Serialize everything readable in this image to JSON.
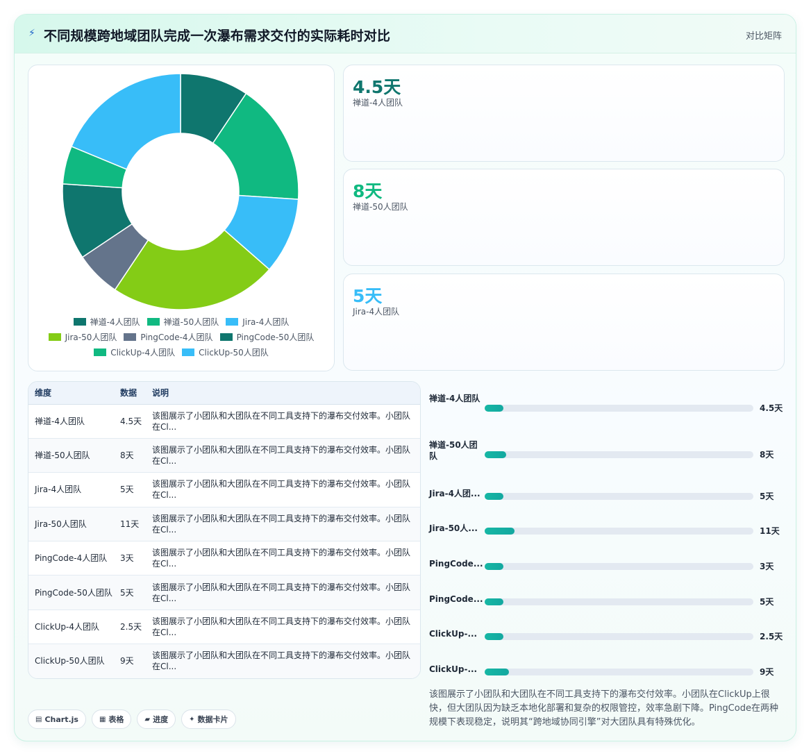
{
  "header": {
    "icon": "bolt-icon",
    "title": "不同规模跨地域团队完成一次瀑布需求交付的实际耗时对比",
    "right_label": "对比矩阵"
  },
  "colors": {
    "dark_teal": "#0f766e",
    "emerald": "#10b981",
    "sky": "#38bdf8",
    "lime": "#84cc16",
    "slate": "#64748b"
  },
  "chart_data": {
    "type": "pie",
    "variant": "donut",
    "categories": [
      "禅道-4人团队",
      "禅道-50人团队",
      "Jira-4人团队",
      "Jira-50人团队",
      "PingCode-4人团队",
      "PingCode-50人团队",
      "ClickUp-4人团队",
      "ClickUp-50人团队"
    ],
    "values": [
      4.5,
      8,
      5,
      11,
      3,
      5,
      2.5,
      9
    ],
    "unit": "天",
    "colors": [
      "#0f766e",
      "#10b981",
      "#38bdf8",
      "#84cc16",
      "#64748b",
      "#0f766e",
      "#10b981",
      "#38bdf8"
    ],
    "legend_position": "bottom"
  },
  "kpis": [
    {
      "value": "4.5天",
      "label": "禅道-4人团队",
      "color": "#0f766e"
    },
    {
      "value": "8天",
      "label": "禅道-50人团队",
      "color": "#10b981"
    },
    {
      "value": "5天",
      "label": "Jira-4人团队",
      "color": "#38bdf8"
    }
  ],
  "table": {
    "headers": [
      "维度",
      "数据",
      "说明"
    ],
    "rows": [
      {
        "dim": "禅道-4人团队",
        "val": "4.5天",
        "desc": "该图展示了小团队和大团队在不同工具支持下的瀑布交付效率。小团队在Cl..."
      },
      {
        "dim": "禅道-50人团队",
        "val": "8天",
        "desc": "该图展示了小团队和大团队在不同工具支持下的瀑布交付效率。小团队在Cl..."
      },
      {
        "dim": "Jira-4人团队",
        "val": "5天",
        "desc": "该图展示了小团队和大团队在不同工具支持下的瀑布交付效率。小团队在Cl..."
      },
      {
        "dim": "Jira-50人团队",
        "val": "11天",
        "desc": "该图展示了小团队和大团队在不同工具支持下的瀑布交付效率。小团队在Cl..."
      },
      {
        "dim": "PingCode-4人团队",
        "val": "3天",
        "desc": "该图展示了小团队和大团队在不同工具支持下的瀑布交付效率。小团队在Cl..."
      },
      {
        "dim": "PingCode-50人团队",
        "val": "5天",
        "desc": "该图展示了小团队和大团队在不同工具支持下的瀑布交付效率。小团队在Cl..."
      },
      {
        "dim": "ClickUp-4人团队",
        "val": "2.5天",
        "desc": "该图展示了小团队和大团队在不同工具支持下的瀑布交付效率。小团队在Cl..."
      },
      {
        "dim": "ClickUp-50人团队",
        "val": "9天",
        "desc": "该图展示了小团队和大团队在不同工具支持下的瀑布交付效率。小团队在Cl..."
      }
    ]
  },
  "progress": {
    "max": 100,
    "items": [
      {
        "name": "禅道-4人团队",
        "value": 4.5,
        "display": "4.5天"
      },
      {
        "name": "禅道-50人团队",
        "value": 8,
        "display": "8天"
      },
      {
        "name": "Jira-4人团...",
        "value": 5,
        "display": "5天"
      },
      {
        "name": "Jira-50人...",
        "value": 11,
        "display": "11天"
      },
      {
        "name": "PingCode...",
        "value": 3,
        "display": "3天"
      },
      {
        "name": "PingCode...",
        "value": 5,
        "display": "5天"
      },
      {
        "name": "ClickUp-...",
        "value": 2.5,
        "display": "2.5天"
      },
      {
        "name": "ClickUp-...",
        "value": 9,
        "display": "9天"
      }
    ]
  },
  "note": "该图展示了小团队和大团队在不同工具支持下的瀑布交付效率。小团队在ClickUp上很快，但大团队因为缺乏本地化部署和复杂的权限管控，效率急剧下降。PingCode在两种规模下表现稳定，说明其“跨地域协同引擎”对大团队具有特殊优化。",
  "chips": [
    {
      "icon": "chart-icon",
      "glyph": "▤",
      "label": "Chart.js"
    },
    {
      "icon": "table-icon",
      "glyph": "▦",
      "label": "表格"
    },
    {
      "icon": "progress-icon",
      "glyph": "▰",
      "label": "进度"
    },
    {
      "icon": "card-icon",
      "glyph": "✦",
      "label": "数据卡片"
    }
  ]
}
